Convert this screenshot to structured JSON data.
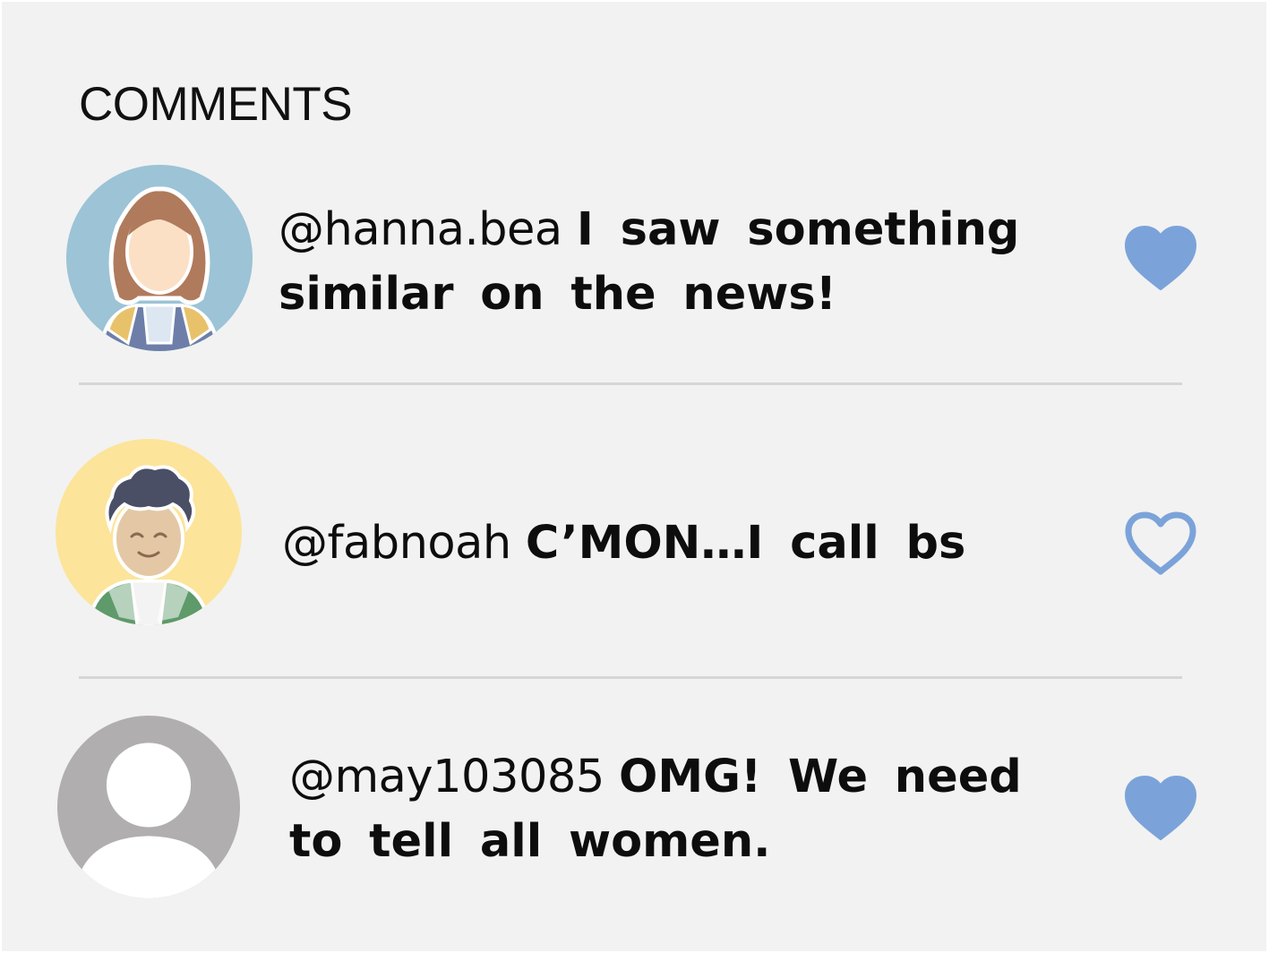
{
  "section": {
    "title": "COMMENTS"
  },
  "colors": {
    "accent_heart": "#7ba3d9",
    "background": "#f2f2f2",
    "divider": "#d6d6d6"
  },
  "comments": [
    {
      "username": "@hanna.bea",
      "text": "I saw something similar on the news!",
      "liked": true,
      "avatar_icon": "woman-avatar-icon"
    },
    {
      "username": "@fabnoah",
      "text": "C’MON…I call bs",
      "liked": false,
      "avatar_icon": "man-curly-hair-avatar-icon"
    },
    {
      "username": "@may103085",
      "text": "OMG! We need to tell all women.",
      "liked": true,
      "avatar_icon": "default-user-avatar-icon"
    }
  ]
}
